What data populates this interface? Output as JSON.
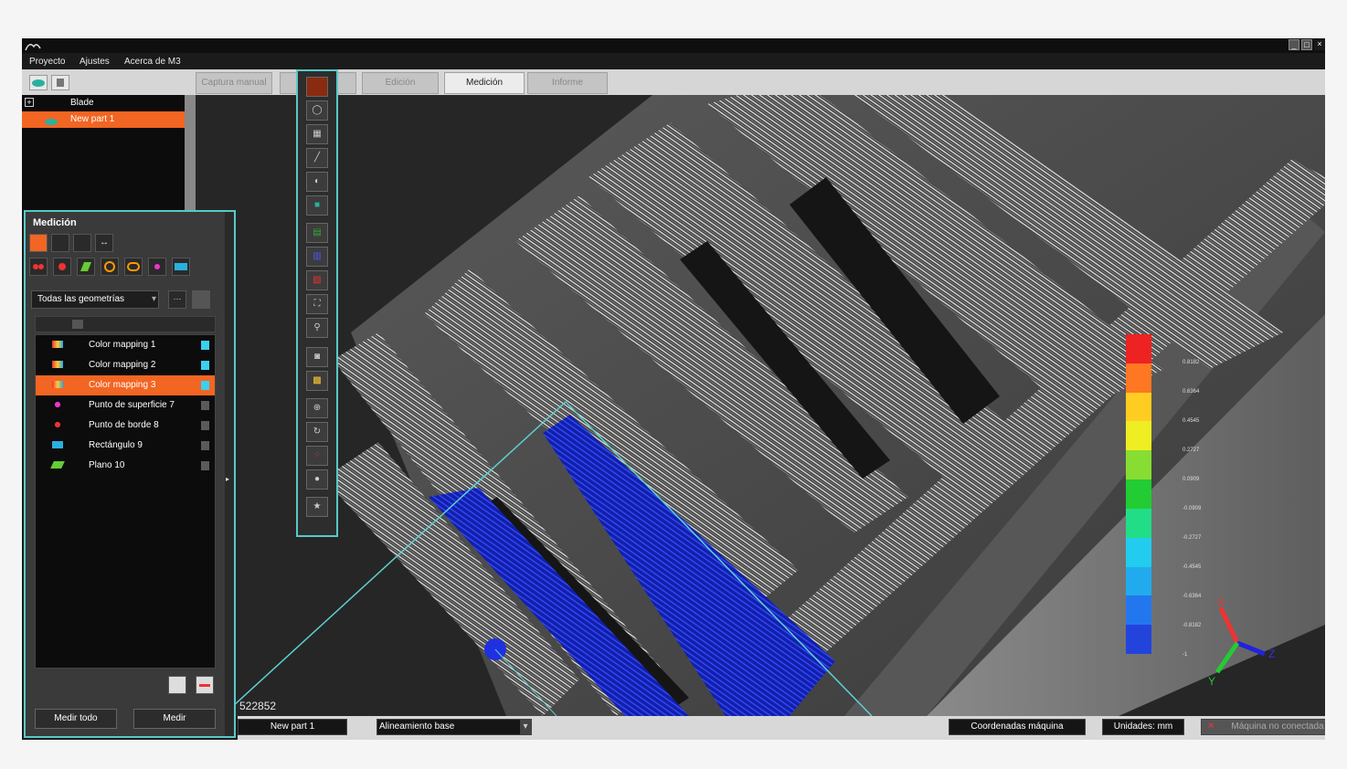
{
  "menu": {
    "items": [
      "Proyecto",
      "Ajustes",
      "Acerca de M3"
    ]
  },
  "tabs": [
    {
      "label": "Captura manual",
      "active": false
    },
    {
      "label": "Edición",
      "active": false
    },
    {
      "label": "Medición",
      "active": true
    },
    {
      "label": "Informe",
      "active": false
    }
  ],
  "tree": {
    "root": "Blade",
    "child": "New part 1"
  },
  "panel": {
    "title": "Medición",
    "filter": "Todas las geometrías",
    "more_label": "···",
    "items": [
      {
        "label": "Color mapping 1",
        "icon": "color-map-icon",
        "checked": true,
        "selected": false
      },
      {
        "label": "Color mapping 2",
        "icon": "color-map-icon",
        "checked": true,
        "selected": false
      },
      {
        "label": "Color mapping 3",
        "icon": "color-map-icon",
        "checked": true,
        "selected": true
      },
      {
        "label": "Punto de superficie 7",
        "icon": "surface-point-icon",
        "checked": false,
        "selected": false
      },
      {
        "label": "Punto de borde 8",
        "icon": "edge-point-icon",
        "checked": false,
        "selected": false
      },
      {
        "label": "Rectángulo 9",
        "icon": "rectangle-icon",
        "checked": false,
        "selected": false
      },
      {
        "label": "Plano 10",
        "icon": "plane-icon",
        "checked": false,
        "selected": false
      }
    ],
    "measure_all": "Medir todo",
    "measure": "Medir"
  },
  "viewport": {
    "point_count": "522852"
  },
  "legend": {
    "colors": [
      "#ee2222",
      "#ff7722",
      "#ffcc22",
      "#eeee22",
      "#88dd33",
      "#22cc33",
      "#22dd88",
      "#22ccee",
      "#22aaee",
      "#2277ee",
      "#2244dd"
    ],
    "labels": [
      "0.8182",
      "0.6364",
      "0.4545",
      "0.2727",
      "0.0909",
      "-0.0909",
      "-0.2727",
      "-0.4545",
      "-0.6364",
      "-0.8182",
      "-1"
    ]
  },
  "axes": {
    "x": "X",
    "y": "Y",
    "z": "Z"
  },
  "status": {
    "part": "New part 1",
    "alignment": "Alineamiento base",
    "coords": "Coordenadas máquina",
    "units": "Unidades: mm",
    "machine": "Máquina no conectada"
  },
  "colors": {
    "accent": "#f26522",
    "highlight": "#59c8c8",
    "selection": "#2233dd"
  }
}
